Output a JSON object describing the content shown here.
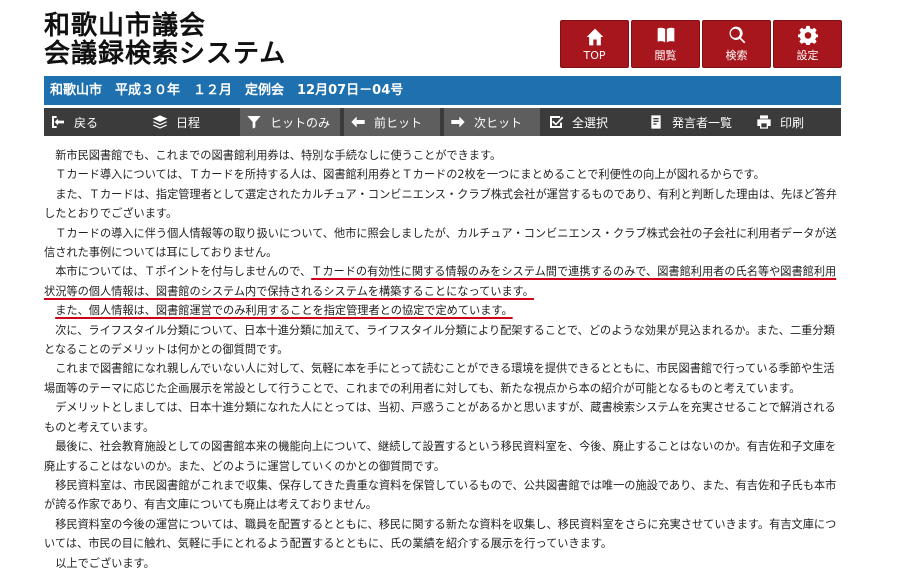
{
  "header": {
    "title_line1": "和歌山市議会",
    "title_line2": "会議録検索システム"
  },
  "topnav": [
    {
      "label": "TOP",
      "icon": "home-icon"
    },
    {
      "label": "閲覧",
      "icon": "book-icon"
    },
    {
      "label": "検索",
      "icon": "search-icon"
    },
    {
      "label": "設定",
      "icon": "gear-icon"
    }
  ],
  "infobar": {
    "text": "和歌山市　平成３０年　１２月　定例会　12月07日－04号"
  },
  "toolbar": {
    "back": "戻る",
    "schedule": "日程",
    "hits_only": "ヒットのみ",
    "prev_hit": "前ヒット",
    "next_hit": "次ヒット",
    "select_all": "全選択",
    "speakers": "発言者一覧",
    "print": "印刷"
  },
  "colors": {
    "header_red": "#a7161c",
    "infobar_blue": "#1f70ae",
    "toolbar_dark": "#3b3b3b",
    "underline_red": "#d0021b"
  },
  "content": {
    "p1": "新市民図書館でも、これまでの図書館利用券は、特別な手続なしに使うことができます。",
    "p2": "Ｔカード導入については、Ｔカードを所持する人は、図書館利用券とＴカードの2枚を一つにまとめることで利便性の向上が図れるからです。",
    "p3": "また、Ｔカードは、指定管理者として選定されたカルチュア・コンビニエンス・クラブ株式会社が運営するものであり、有利と判断した理由は、先ほど答弁したとおりでございます。",
    "p4": "Ｔカードの導入に伴う個人情報等の取り扱いについて、他市に照会しましたが、カルチュア・コンビニエンス・クラブ株式会社の子会社に利用者データが送信された事例については耳にしておりません。",
    "p5a": "本市については、Ｔポイントを付与しませんので、",
    "p5b": "Ｔカードの有効性に関する情報のみをシステム間で連携するのみで、図書館利用者の氏名等や図書館利用状況等の個人情報は、図書館のシステム内で保持されるシステムを構築することになっています。",
    "p6": "また、個人情報は、図書館運営でのみ利用することを指定管理者との協定で定めています。",
    "p7": "次に、ライフスタイル分類について、日本十進分類に加えて、ライフスタイル分類により配架することで、どのような効果が見込まれるか。また、二重分類となることのデメリットは何かとの御質問です。",
    "p8": "これまで図書館になれ親しんでいない人に対して、気軽に本を手にとって読むことができる環境を提供できるとともに、市民図書館で行っている季節や生活場面等のテーマに応じた企画展示を常設として行うことで、これまでの利用者に対しても、新たな視点から本の紹介が可能となるものと考えています。",
    "p9": "デメリットとしましては、日本十進分類になれた人にとっては、当初、戸惑うことがあるかと思いますが、蔵書検索システムを充実させることで解消されるものと考えています。",
    "p10": "最後に、社会教育施設としての図書館本来の機能向上について、継続して設置するという移民資料室を、今後、廃止することはないのか。有吉佐和子文庫を廃止することはないのか。また、どのように運営していくのかとの御質問です。",
    "p11": "移民資料室は、市民図書館がこれまで収集、保存してきた貴重な資料を保管しているもので、公共図書館では唯一の施設であり、また、有吉佐和子氏も本市が誇る作家であり、有吉文庫についても廃止は考えておりません。",
    "p12": "移民資料室の今後の運営については、職員を配置するとともに、移民に関する新たな資料を収集し、移民資料室をさらに充実させていきます。有吉文庫については、市民の目に触れ、気軽に手にとれるよう配置するとともに、氏の業績を紹介する展示を行っていきます。",
    "p13": "以上でございます。"
  }
}
